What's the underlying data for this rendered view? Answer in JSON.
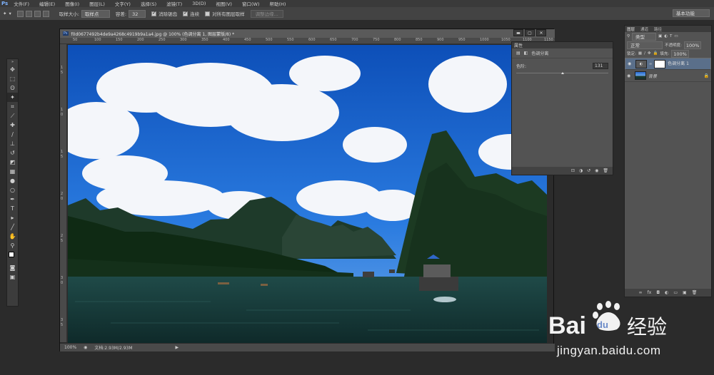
{
  "menubar": {
    "app_logo": "Ps",
    "items": [
      "文件(F)",
      "编辑(E)",
      "图像(I)",
      "图层(L)",
      "文字(Y)",
      "选择(S)",
      "滤镜(T)",
      "3D(D)",
      "视图(V)",
      "窗口(W)",
      "帮助(H)"
    ]
  },
  "options": {
    "sample_size_label": "取样大小:",
    "sample_size_value": "取样点",
    "tolerance_label": "容差:",
    "tolerance_value": "32",
    "antialias_label": "消除锯齿",
    "contiguous_label": "连续",
    "all_layers_label": "对所有图层取样",
    "refine_edge_label": "调整边缘...",
    "workspace": "基本功能"
  },
  "document": {
    "tab_title": "f0d0677492b4de9a4268c4919b9a1a4.jpg @ 100% (色调分离 1, 图层蒙版/8) *",
    "ruler_top": [
      "50",
      "100",
      "150",
      "200",
      "250",
      "300",
      "350",
      "400",
      "450",
      "500",
      "550",
      "600",
      "650",
      "700",
      "750",
      "800",
      "850",
      "900",
      "950",
      "1000",
      "1050",
      "1100",
      "1150"
    ],
    "ruler_left": [
      "1",
      "5",
      "1",
      "0",
      "1",
      "5",
      "2",
      "0",
      "2",
      "5",
      "3",
      "0",
      "3",
      "5"
    ],
    "zoom": "100%",
    "doc_size": "文档:2.93M/2.93M"
  },
  "properties": {
    "title": "属性",
    "adjustment_name": "色调分离",
    "levels_label": "色阶:",
    "levels_value": "131",
    "levels_fraction": 0.5
  },
  "layers": {
    "tabs": [
      "图层",
      "通道",
      "路径"
    ],
    "kind_label": "类型",
    "blend_mode": "正常",
    "opacity_label": "不透明度:",
    "opacity_value": "100%",
    "lock_label": "锁定:",
    "fill_label": "填充:",
    "fill_value": "100%",
    "items": [
      {
        "name": "色调分离 1"
      },
      {
        "name": "背景"
      }
    ]
  },
  "watermark": {
    "brand": "Bai",
    "brand2": "du",
    "suffix": "经验",
    "url": "jingyan.baidu.com"
  }
}
